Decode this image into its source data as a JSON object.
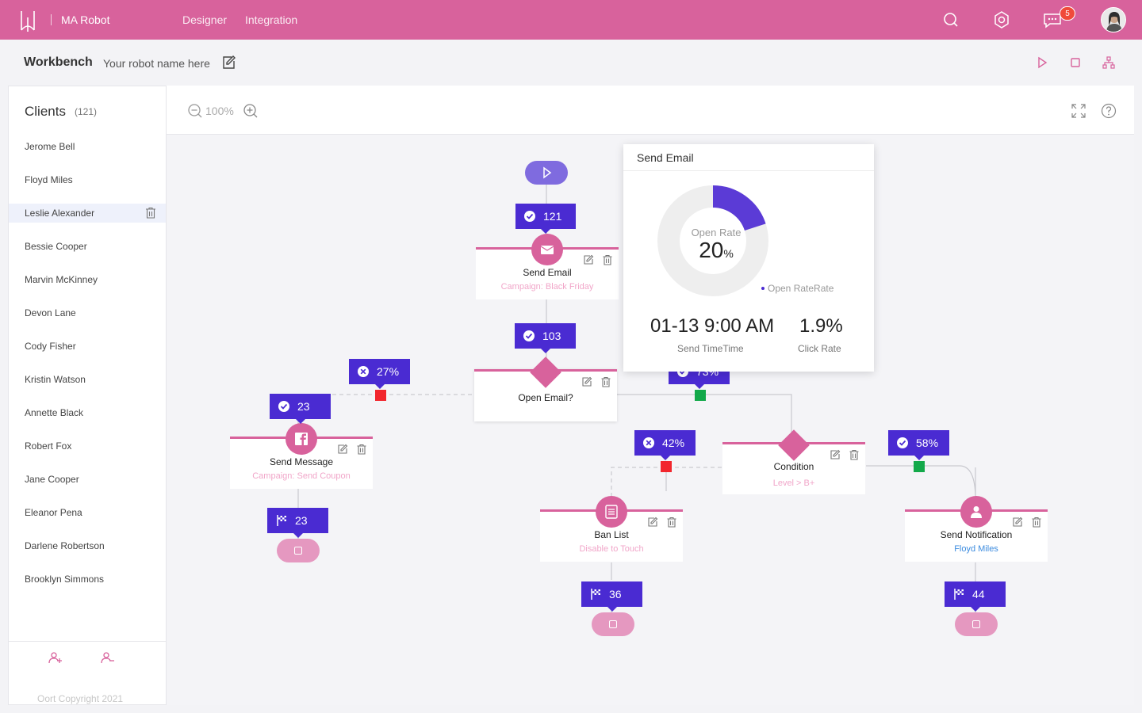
{
  "header": {
    "app_name": "MA Robot",
    "nav": [
      "Designer",
      "Integration"
    ],
    "notification_count": "5"
  },
  "workbench": {
    "title": "Workbench",
    "robot_name": "Your robot name here"
  },
  "sidebar": {
    "title": "Clients",
    "count": "(121)",
    "clients": [
      "Jerome Bell",
      "Floyd Miles",
      "Leslie Alexander",
      "Bessie Cooper",
      "Marvin McKinney",
      "Devon Lane",
      "Cody Fisher",
      "Kristin Watson",
      "Annette Black",
      "Robert Fox",
      "Jane Cooper",
      "Eleanor Pena",
      "Darlene Robertson",
      "Brooklyn Simmons"
    ],
    "active_client": "Leslie Alexander",
    "copyright": "Oort Copyright 2021"
  },
  "toolbar": {
    "zoom": "100%"
  },
  "flow": {
    "nodes": {
      "send_email": {
        "title": "Send Email",
        "sub": "Campaign: Black Friday"
      },
      "open_email": {
        "title": "Open Email?"
      },
      "send_message": {
        "title": "Send Message",
        "sub": "Campaign: Send Coupon"
      },
      "condition": {
        "title": "Condition",
        "sub": "Level > B+"
      },
      "ban_list": {
        "title": "Ban List",
        "sub": "Disable to Touch"
      },
      "send_notification": {
        "title": "Send Notification",
        "sub": "Floyd Miles"
      }
    },
    "tags": {
      "t121": "121",
      "t103": "103",
      "t27": "27%",
      "t73": "73%",
      "t23": "23",
      "t42": "42%",
      "t58": "58%",
      "end23": "23",
      "end36": "36",
      "end44": "44"
    }
  },
  "popup": {
    "title": "Send Email",
    "donut_label": "Open Rate",
    "donut_value": "20",
    "donut_unit": "%",
    "open_rate_fraction": 0.2,
    "legend": "Open RateRate",
    "send_time": "01-13 9:00 AM",
    "send_time_label": "Send TimeTime",
    "click_rate": "1.9%",
    "click_rate_label": "Click Rate"
  },
  "colors": {
    "brand_pink": "#d8629c",
    "tag_purple": "#4a2bd2",
    "gate_red": "#f2262d",
    "gate_green": "#13a94a"
  }
}
